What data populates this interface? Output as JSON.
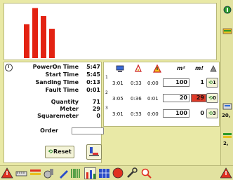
{
  "chart_data": {
    "type": "bar",
    "values": [
      5.9,
      8.7,
      7.3,
      5.1
    ],
    "bar_color": "#e32212"
  },
  "info": {
    "poweron_label": "PowerOn Time",
    "poweron_value": "5:47",
    "start_label": "Start Time",
    "start_value": "5:45",
    "sanding_label": "Sanding Time",
    "sanding_value": "0:13",
    "fault_label": "Fault Time",
    "fault_value": "0:01",
    "quantity_label": "Quantity",
    "quantity_value": "71",
    "meter_label": "Meter",
    "meter_value": "29",
    "squaremeter_label": "Squaremeter",
    "squaremeter_value": "0",
    "order_label": "Order",
    "order_value": ""
  },
  "reset_label": "Reset",
  "table": {
    "header_m2": "m²",
    "header_m": "m!",
    "rows": [
      {
        "num": "1",
        "a": "3:01",
        "b": "0:33",
        "c": "0:00",
        "m2": "100",
        "m": "1",
        "btn": "1",
        "m_color": "#ffffff"
      },
      {
        "num": "2",
        "a": "3:05",
        "b": "0:36",
        "c": "0:01",
        "m2": "20",
        "m": "29",
        "btn": "0",
        "m_color": "#e03a28"
      },
      {
        "num": "3",
        "a": "3:01",
        "b": "0:33",
        "c": "0:00",
        "m2": "100",
        "m": "0",
        "btn": "3",
        "m_color": "#ffffff"
      }
    ]
  },
  "strip": {
    "label_1": "20,",
    "label_2": "2,"
  },
  "icons": [
    "clock-icon",
    "computer-icon",
    "warning-bell-icon",
    "warning-triangle-icon",
    "sander-icon",
    "reset-icon",
    "tool-icon"
  ]
}
